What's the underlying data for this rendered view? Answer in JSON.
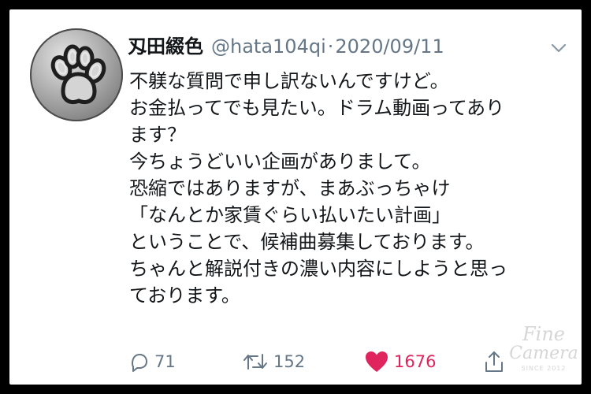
{
  "tweet": {
    "display_name": "刄田綴色",
    "handle": "@hata104qi",
    "separator": "·",
    "date": "2020/09/11",
    "lines": [
      "不躾な質問で申し訳ないんですけど。",
      "お金払ってでも見たい。ドラム動画ってあり",
      "ます？",
      "今ちょうどいい企画がありまして。",
      "恐縮ではありますが、まあぶっちゃけ",
      "「なんとか家賃ぐらい払いたい計画」",
      "ということで、候補曲募集しております。",
      "ちゃんと解説付きの濃い内容にしようと思っ",
      "ております。"
    ],
    "liked": true
  },
  "actions": {
    "reply_count": "71",
    "retweet_count": "152",
    "like_count": "1676"
  },
  "colors": {
    "like": "#e0245e",
    "meta": "#657786",
    "text": "#14171a"
  },
  "icons": {
    "avatar": "paw-print-icon",
    "caret": "chevron-down-icon",
    "reply": "reply-icon",
    "retweet": "retweet-icon",
    "like": "heart-icon",
    "share": "share-icon"
  },
  "watermark": {
    "line1": "Fine",
    "line2": "Camera",
    "line3": "SINCE 2012"
  }
}
